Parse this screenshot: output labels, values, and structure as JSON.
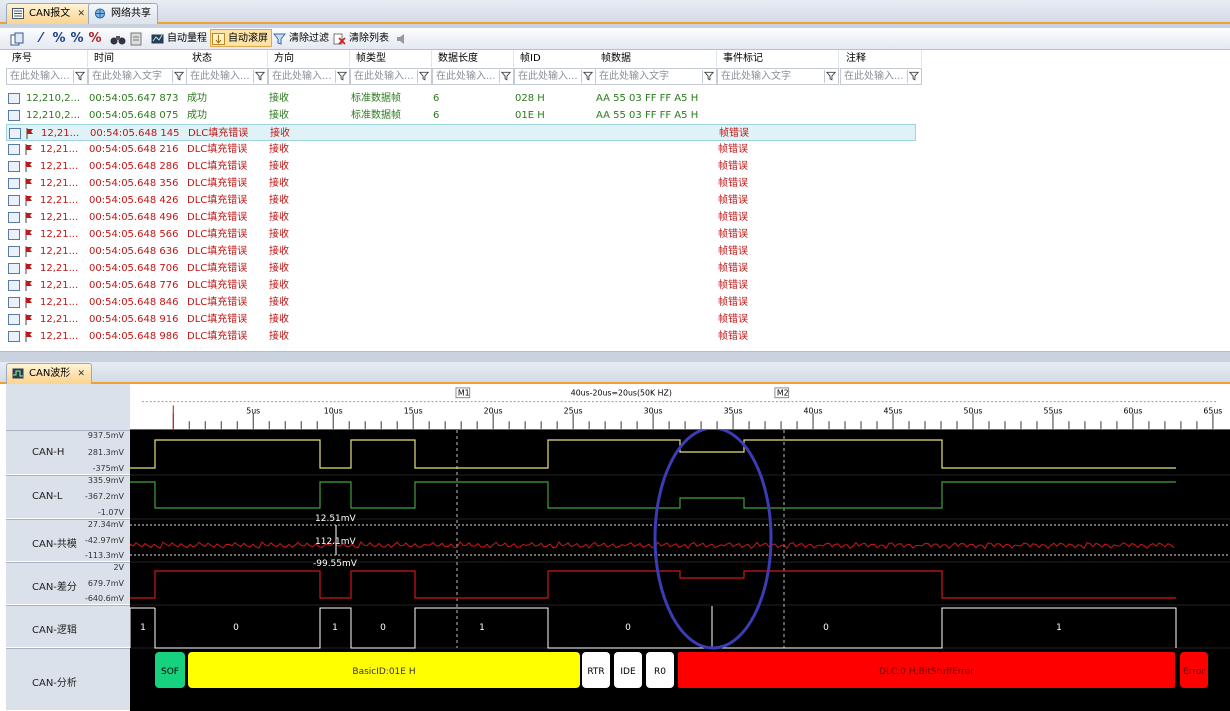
{
  "tabs": {
    "can_msg": "CAN报文",
    "net_share": "网络共享",
    "wave": "CAN波形"
  },
  "toolbar": {
    "auto_range": "自动量程",
    "auto_scroll": "自动滚屏",
    "clear_filter": "清除过滤",
    "clear_list": "清除列表"
  },
  "table": {
    "headers": [
      "序号",
      "时间",
      "状态",
      "方向",
      "帧类型",
      "数据长度",
      "帧ID",
      "帧数据",
      "事件标记",
      "注释"
    ],
    "filter_placeholders": [
      "在此处输入...",
      "在此处输入文字",
      "在此处输入...",
      "在此处输入...",
      "在此处输入...",
      "在此处输入...",
      "在此处输入...",
      "在此处输入文字",
      "在此处输入文字",
      "在此处输入..."
    ],
    "rows": [
      {
        "no": "12,210,2...",
        "time": "00:54:05.647 873",
        "status": "成功",
        "dir": "接收",
        "type": "标准数据帧",
        "len": "6",
        "id": "028 H",
        "data": "AA 55 03 FF FF A5 H",
        "event": "",
        "kind": "ok"
      },
      {
        "no": "12,210,2...",
        "time": "00:54:05.648 075",
        "status": "成功",
        "dir": "接收",
        "type": "标准数据帧",
        "len": "6",
        "id": "01E H",
        "data": "AA 55 03 FF FF A5 H",
        "event": "",
        "kind": "ok"
      },
      {
        "no": "12,21...",
        "time": "00:54:05.648 145",
        "status": "DLC填充错误",
        "dir": "接收",
        "type": "",
        "len": "",
        "id": "",
        "data": "",
        "event": "帧错误",
        "kind": "err"
      },
      {
        "no": "12,21...",
        "time": "00:54:05.648 216",
        "status": "DLC填充错误",
        "dir": "接收",
        "type": "",
        "len": "",
        "id": "",
        "data": "",
        "event": "帧错误",
        "kind": "err"
      },
      {
        "no": "12,21...",
        "time": "00:54:05.648 286",
        "status": "DLC填充错误",
        "dir": "接收",
        "type": "",
        "len": "",
        "id": "",
        "data": "",
        "event": "帧错误",
        "kind": "err"
      },
      {
        "no": "12,21...",
        "time": "00:54:05.648 356",
        "status": "DLC填充错误",
        "dir": "接收",
        "type": "",
        "len": "",
        "id": "",
        "data": "",
        "event": "帧错误",
        "kind": "err"
      },
      {
        "no": "12,21...",
        "time": "00:54:05.648 426",
        "status": "DLC填充错误",
        "dir": "接收",
        "type": "",
        "len": "",
        "id": "",
        "data": "",
        "event": "帧错误",
        "kind": "err"
      },
      {
        "no": "12,21...",
        "time": "00:54:05.648 496",
        "status": "DLC填充错误",
        "dir": "接收",
        "type": "",
        "len": "",
        "id": "",
        "data": "",
        "event": "帧错误",
        "kind": "err"
      },
      {
        "no": "12,21...",
        "time": "00:54:05.648 566",
        "status": "DLC填充错误",
        "dir": "接收",
        "type": "",
        "len": "",
        "id": "",
        "data": "",
        "event": "帧错误",
        "kind": "err"
      },
      {
        "no": "12,21...",
        "time": "00:54:05.648 636",
        "status": "DLC填充错误",
        "dir": "接收",
        "type": "",
        "len": "",
        "id": "",
        "data": "",
        "event": "帧错误",
        "kind": "err"
      },
      {
        "no": "12,21...",
        "time": "00:54:05.648 706",
        "status": "DLC填充错误",
        "dir": "接收",
        "type": "",
        "len": "",
        "id": "",
        "data": "",
        "event": "帧错误",
        "kind": "err"
      },
      {
        "no": "12,21...",
        "time": "00:54:05.648 776",
        "status": "DLC填充错误",
        "dir": "接收",
        "type": "",
        "len": "",
        "id": "",
        "data": "",
        "event": "帧错误",
        "kind": "err"
      },
      {
        "no": "12,21...",
        "time": "00:54:05.648 846",
        "status": "DLC填充错误",
        "dir": "接收",
        "type": "",
        "len": "",
        "id": "",
        "data": "",
        "event": "帧错误",
        "kind": "err"
      },
      {
        "no": "12,21...",
        "time": "00:54:05.648 916",
        "status": "DLC填充错误",
        "dir": "接收",
        "type": "",
        "len": "",
        "id": "",
        "data": "",
        "event": "帧错误",
        "kind": "err"
      },
      {
        "no": "12,21...",
        "time": "00:54:05.648 986",
        "status": "DLC填充错误",
        "dir": "接收",
        "type": "",
        "len": "",
        "id": "",
        "data": "",
        "event": "帧错误",
        "kind": "err"
      }
    ]
  },
  "wave": {
    "markers": {
      "m1": "M1",
      "m2": "M2",
      "measure": "40us-20us=20us(50K HZ)"
    },
    "ticks": [
      "5us",
      "10us",
      "15us",
      "20us",
      "25us",
      "30us",
      "35us",
      "40us",
      "45us",
      "50us",
      "55us",
      "60us",
      "65us"
    ],
    "channels": [
      {
        "name": "CAN-H",
        "vals": [
          "937.5mV",
          "281.3mV",
          "-375mV"
        ]
      },
      {
        "name": "CAN-L",
        "vals": [
          "335.9mV",
          "-367.2mV",
          "-1.07V"
        ]
      },
      {
        "name": "CAN-共模",
        "vals": [
          "27.34mV",
          "-42.97mV",
          "-113.3mV"
        ]
      },
      {
        "name": "CAN-差分",
        "vals": [
          "2V",
          "679.7mV",
          "-640.6mV"
        ]
      },
      {
        "name": "CAN-逻辑",
        "vals": []
      },
      {
        "name": "CAN-分析",
        "vals": []
      }
    ],
    "cursor_readouts": {
      "top": "12.51mV",
      "mid": "112.1mV",
      "bot": "-99.55mV"
    },
    "logic_bits": [
      "1",
      "0",
      "1",
      "0",
      "1",
      "0",
      "0",
      "1"
    ],
    "analysis": {
      "sof": "SOF",
      "id": "BasicID:01E H",
      "rtr": "RTR",
      "ide": "IDE",
      "r0": "R0",
      "dlc": "DLC:0 H;BitStuffError",
      "err": "Error"
    },
    "colors": {
      "canh": "#e8e07a",
      "canl": "#3fa23a",
      "red": "#d01818",
      "highlight": "#3c3cb4",
      "sof": "#16d27f",
      "yellow": "#ffff00",
      "error": "#ff0000"
    }
  }
}
